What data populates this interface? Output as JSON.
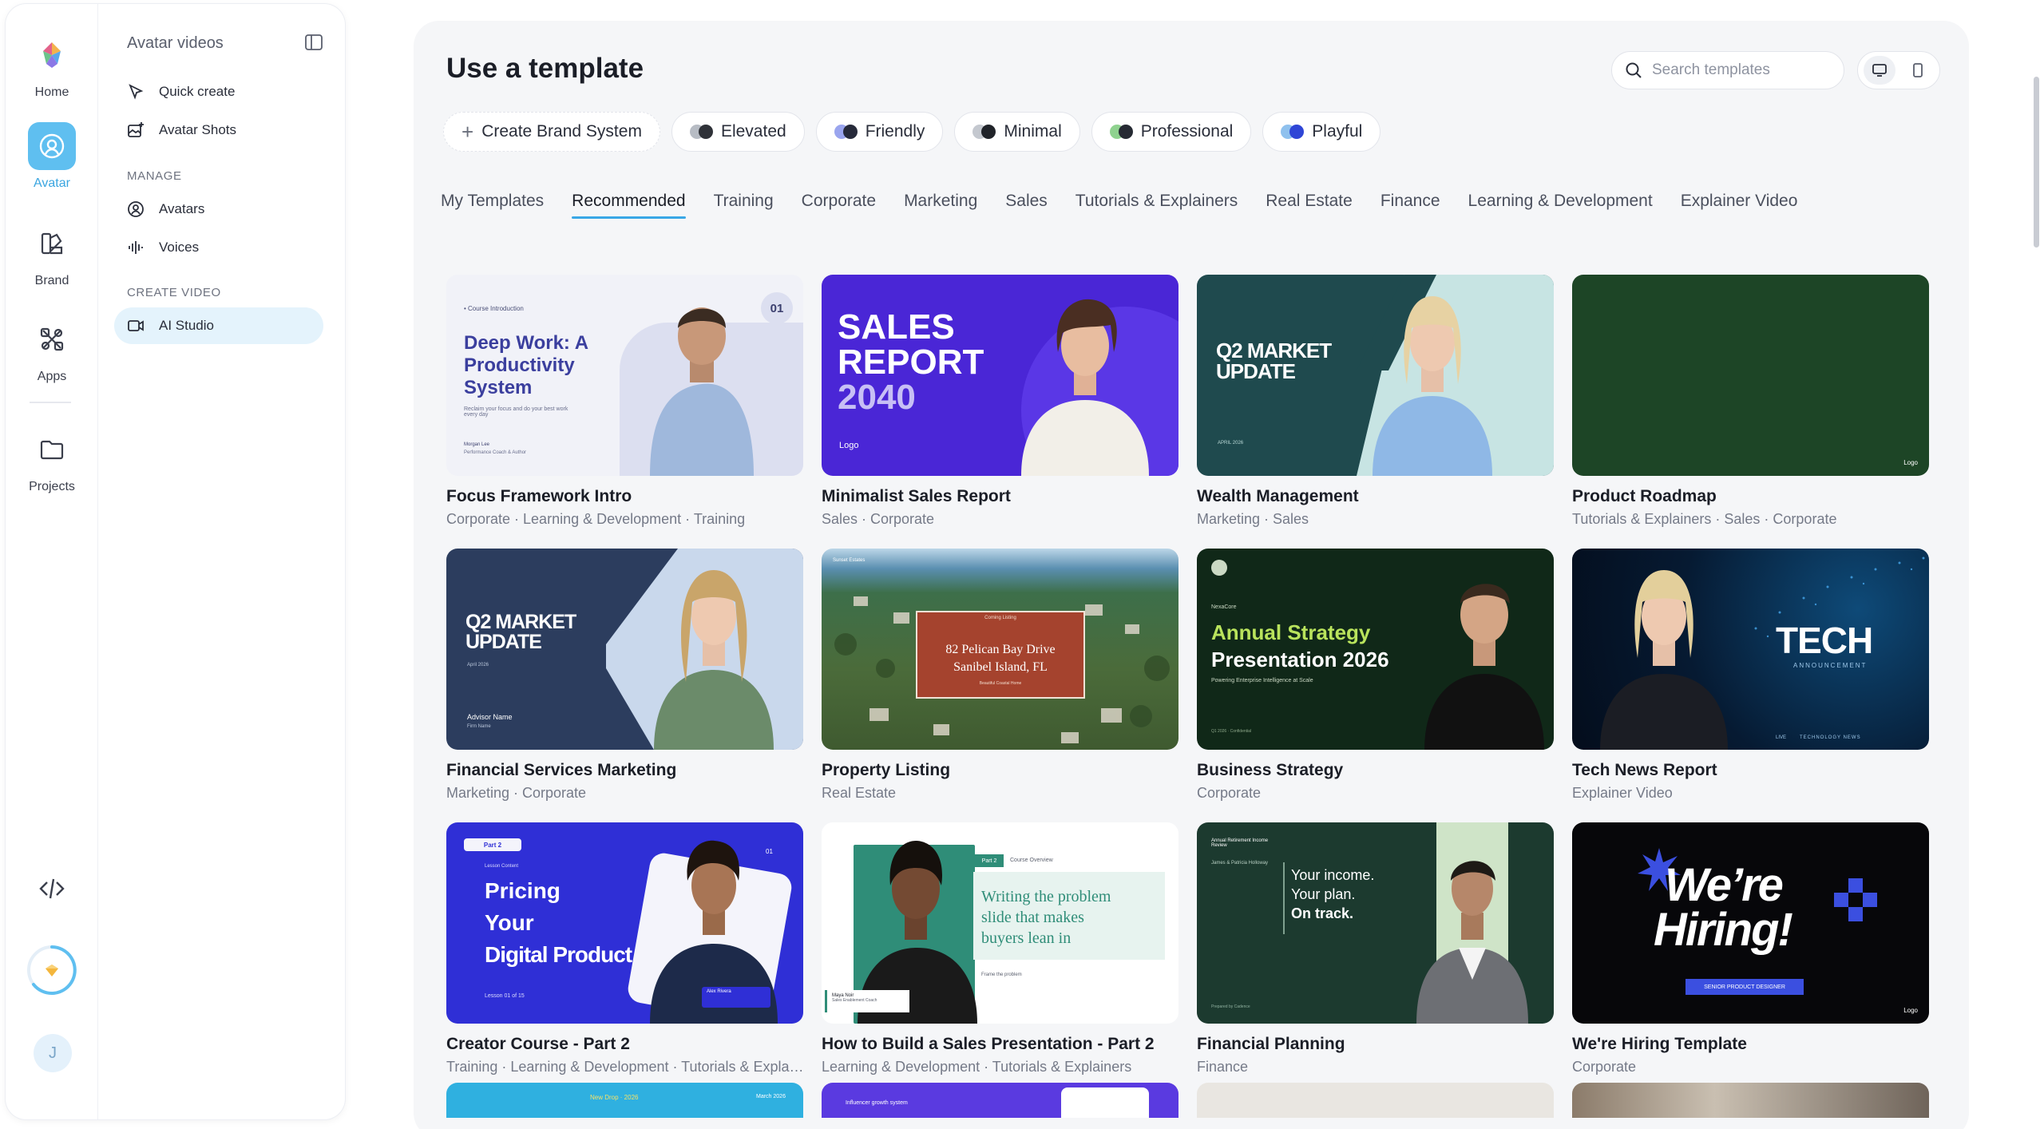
{
  "rail": {
    "items": [
      {
        "label": "Home"
      },
      {
        "label": "Avatar"
      },
      {
        "label": "Brand"
      },
      {
        "label": "Apps"
      },
      {
        "label": "Projects"
      }
    ],
    "user_initial": "J"
  },
  "sidebar": {
    "title": "Avatar videos",
    "quick_create": "Quick create",
    "avatar_shots": "Avatar Shots",
    "manage_heading": "MANAGE",
    "avatars": "Avatars",
    "voices": "Voices",
    "create_heading": "CREATE VIDEO",
    "ai_studio": "AI Studio"
  },
  "main": {
    "title": "Use a template",
    "search_placeholder": "Search templates",
    "chips": [
      {
        "label": "Create Brand System"
      },
      {
        "label": "Elevated",
        "colors": [
          "#b7bcc4",
          "#2f3238"
        ]
      },
      {
        "label": "Friendly",
        "colors": [
          "#9aa5ee",
          "#262a3a"
        ]
      },
      {
        "label": "Minimal",
        "colors": [
          "#c4c8cf",
          "#202329"
        ]
      },
      {
        "label": "Professional",
        "colors": [
          "#8fd28f",
          "#262a33"
        ]
      },
      {
        "label": "Playful",
        "colors": [
          "#8fc1ee",
          "#2f46d6"
        ]
      }
    ],
    "tabs": [
      "My Templates",
      "Recommended",
      "Training",
      "Corporate",
      "Marketing",
      "Sales",
      "Tutorials & Explainers",
      "Real Estate",
      "Finance",
      "Learning & Development",
      "Explainer Video"
    ],
    "active_tab": "Recommended"
  },
  "cards": [
    {
      "title": "Focus Framework Intro",
      "tags": "Corporate · Learning & Development · Training",
      "t1": "Deep Work: A Productivity System",
      "t2": "01",
      "t3": "• Course Introduction",
      "t4": "Reclaim your focus and do your best work every day",
      "t5": "Morgan Lee",
      "t6": "Performance Coach & Author"
    },
    {
      "title": "Minimalist Sales Report",
      "tags": "Sales · Corporate",
      "t1": "SALES",
      "t2": "REPORT",
      "t3": "2040",
      "t4": "Logo"
    },
    {
      "title": "Wealth Management",
      "tags": "Marketing · Sales",
      "t1": "Q2 MARKET",
      "t2": "UPDATE",
      "t3": "APRIL 2026"
    },
    {
      "title": "Product Roadmap",
      "tags": "Tutorials & Explainers · Sales · Corporate",
      "t1": "Logo"
    },
    {
      "title": "Financial Services Marketing",
      "tags": "Marketing · Corporate",
      "t1": "Q2 MARKET",
      "t2": "UPDATE",
      "t3": "Advisor Name",
      "t4": "April 2026",
      "t5": "Firm Name"
    },
    {
      "title": "Property Listing",
      "tags": "Real Estate",
      "t1": "82 Pelican Bay Drive",
      "t2": "Sanibel Island, FL",
      "t3": "Coming Listing",
      "t4": "Sunset Estates",
      "t5": "Beautiful Coastal Home"
    },
    {
      "title": "Business Strategy",
      "tags": "Corporate",
      "t1": "Annual Strategy",
      "t2": "Presentation 2026",
      "t3": "Powering Enterprise Intelligence at Scale",
      "t4": "NexaCore",
      "t5": "Q1 2026 · Confidential"
    },
    {
      "title": "Tech News Report",
      "tags": "Explainer Video",
      "t1": "TECH",
      "t2": "ANNOUNCEMENT",
      "t3": "LIVE",
      "t4": "TECHNOLOGY NEWS"
    },
    {
      "title": "Creator Course - Part 2",
      "tags": "Training · Learning & Development · Tutorials & Explainers",
      "t1": "Pricing",
      "t2": "Your",
      "t3": "Digital Product",
      "t4": "Part 2",
      "t5": "Lesson 01 of 15",
      "t6": "01",
      "t7": "Alex Rivera",
      "t8": "Lesson Content"
    },
    {
      "title": "How to Build a Sales Presentation - Part 2",
      "tags": "Learning & Development · Tutorials & Explainers",
      "t1": "Writing the problem",
      "t2": "slide that makes",
      "t3": "buyers lean in",
      "t4": "Part 2",
      "t5": "Course Overview",
      "t6": "Frame the problem",
      "t7": "Maya Noir",
      "t8": "Sales Enablement Coach"
    },
    {
      "title": "Financial Planning",
      "tags": "Finance",
      "t1": "Your income.",
      "t2": "Your plan.",
      "t3": "On track.",
      "t4": "Annual Retirement Income Review",
      "t5": "James & Patricia Holloway",
      "t6": "Prepared by Cadence"
    },
    {
      "title": "We're Hiring Template",
      "tags": "Corporate",
      "t1": "We’re",
      "t2": "Hiring!",
      "t3": "SENIOR PRODUCT DESIGNER",
      "t4": "Logo"
    }
  ],
  "partial": [
    {
      "t1": "New Drop · 2026",
      "t2": "March 2026"
    },
    {
      "t1": "Influencer growth system"
    },
    {},
    {}
  ]
}
